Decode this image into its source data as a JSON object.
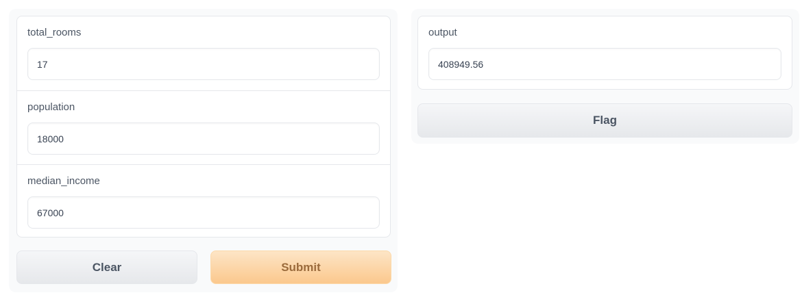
{
  "inputs": {
    "total_rooms": {
      "label": "total_rooms",
      "value": "17"
    },
    "population": {
      "label": "population",
      "value": "18000"
    },
    "median_income": {
      "label": "median_income",
      "value": "67000"
    }
  },
  "output": {
    "label": "output",
    "value": "408949.56"
  },
  "buttons": {
    "clear": "Clear",
    "submit": "Submit",
    "flag": "Flag"
  },
  "colors": {
    "primary_button": "#fbc88d",
    "secondary_button": "#e6e8eb",
    "panel_border": "#e5e7eb",
    "column_background": "#f9fafb"
  }
}
